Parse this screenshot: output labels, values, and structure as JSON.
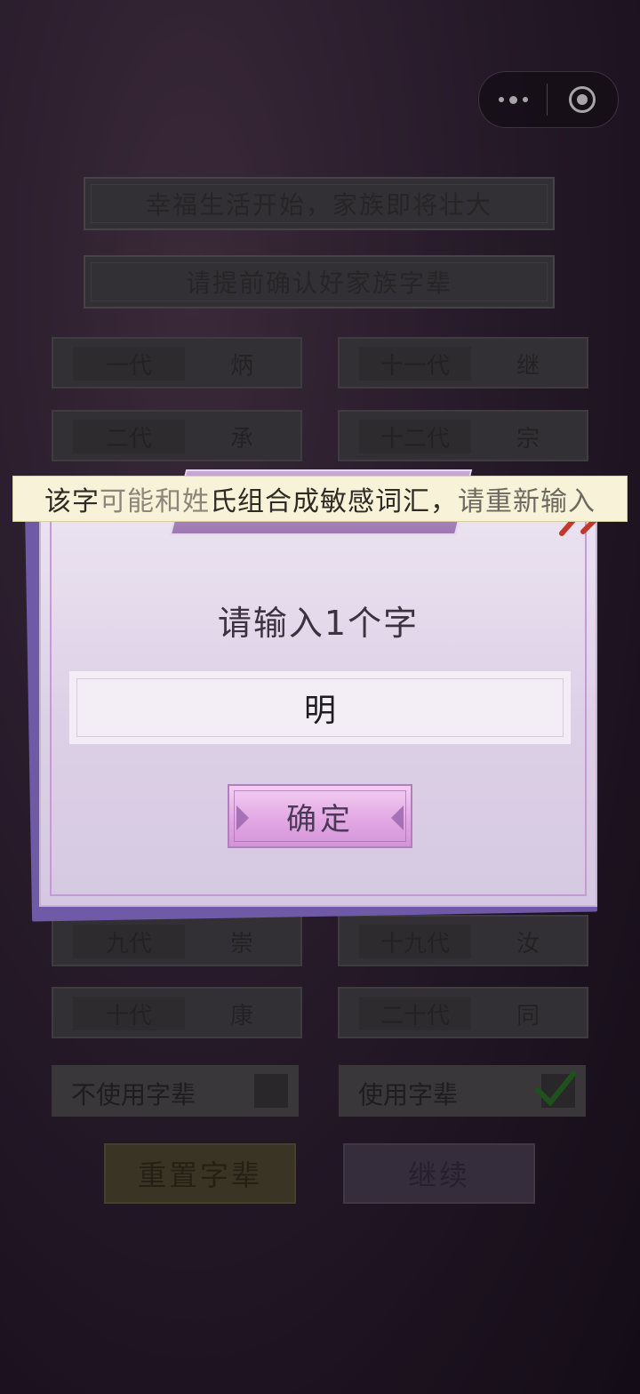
{
  "banners": {
    "line1": "幸福生活开始，家族即将壮大",
    "line2": "请提前确认好家族字辈"
  },
  "generations": {
    "g1": {
      "label": "一代",
      "char": "炳"
    },
    "g11": {
      "label": "十一代",
      "char": "继"
    },
    "g2": {
      "label": "二代",
      "char": "承"
    },
    "g12": {
      "label": "十二代",
      "char": "宗"
    },
    "g9": {
      "label": "九代",
      "char": "崇"
    },
    "g19": {
      "label": "十九代",
      "char": "汝"
    },
    "g10": {
      "label": "十代",
      "char": "康"
    },
    "g20": {
      "label": "二十代",
      "char": "同"
    }
  },
  "options": {
    "no_use_label": "不使用字辈",
    "use_label": "使用字辈",
    "use_checked": true
  },
  "buttons": {
    "reset": "重置字辈",
    "continue": "继续"
  },
  "dialog": {
    "prompt": "请输入1个字",
    "input_value": "明",
    "confirm": "确定"
  },
  "toast": {
    "part1": "该字",
    "part2": "可能和姓",
    "part3": "氏组合成敏感词汇，",
    "part4": "请重新输入"
  },
  "colors": {
    "background": "#3f2b43",
    "dialog_bg": "#e4daeb",
    "confirm_button": "#e3a8e4",
    "toast_bg": "#f8f2d8",
    "check": "#2f8f2a"
  }
}
